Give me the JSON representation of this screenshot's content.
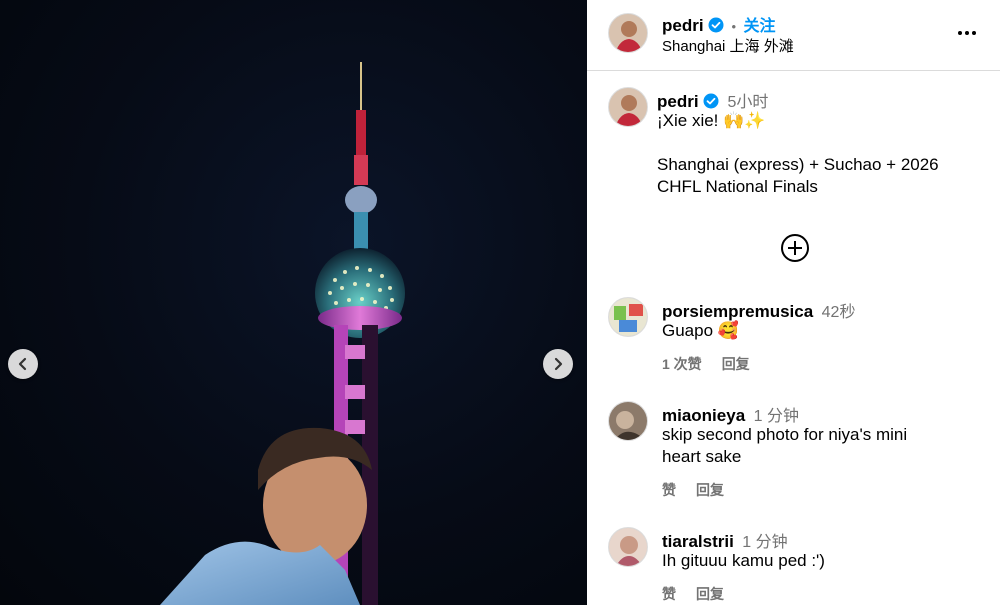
{
  "header": {
    "username": "pedri",
    "separator": "•",
    "follow_label": "关注",
    "location": "Shanghai 上海 外滩"
  },
  "caption": {
    "username": "pedri",
    "time": "5小时",
    "line1": "¡Xie xie! 🙌✨",
    "line2": "Shanghai (express) + Suchao + 2026",
    "line3": "CHFL National Finals"
  },
  "comments": [
    {
      "username": "porsiempremusica",
      "time": "42秒",
      "text_lines": [
        "Guapo 🥰"
      ],
      "likes_label": "1 次赞",
      "reply_label": "回复"
    },
    {
      "username": "miaonieya",
      "time": "1 分钟",
      "text_lines": [
        "skip second photo for niya's mini",
        "heart sake"
      ],
      "likes_label": "赞",
      "reply_label": "回复"
    },
    {
      "username": "tiaralstrii",
      "time": "1 分钟",
      "text_lines": [
        "Ih gituuu kamu ped :')"
      ],
      "likes_label": "赞",
      "reply_label": "回复"
    }
  ],
  "icons": {
    "verified": "verified-badge-icon",
    "more": "more-options-icon",
    "add": "add-circle-icon",
    "prev": "chevron-left-icon",
    "next": "chevron-right-icon"
  },
  "colors": {
    "accent": "#0095f6",
    "muted": "#737373",
    "divider": "#dbdbdb"
  }
}
